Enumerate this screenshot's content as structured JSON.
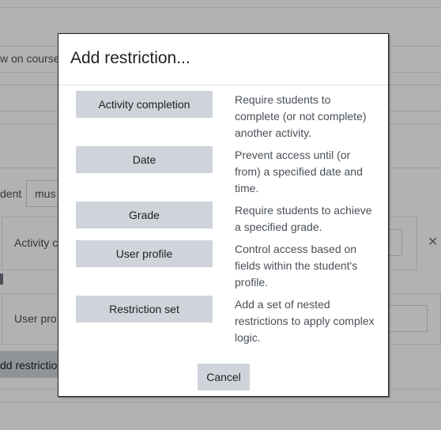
{
  "background": {
    "fragments": {
      "show_on_course": "w on course",
      "student_label": "dent",
      "must_select": "mus",
      "activity_completion_partial": "Activity c",
      "user_profile_partial": "User pro",
      "add_restriction_partial": "dd restrictio",
      "select_arrow": "↕",
      "close_glyph": "✕"
    }
  },
  "modal": {
    "title": "Add restriction...",
    "options": [
      {
        "label": "Activity completion",
        "description": "Require students to complete (or not complete) another activity."
      },
      {
        "label": "Date",
        "description": "Prevent access until (or from) a specified date and time."
      },
      {
        "label": "Grade",
        "description": "Require students to achieve a specified grade."
      },
      {
        "label": "User profile",
        "description": "Control access based on fields within the student's profile."
      },
      {
        "label": "Restriction set",
        "description": "Add a set of nested restrictions to apply complex logic."
      }
    ],
    "cancel_label": "Cancel"
  }
}
